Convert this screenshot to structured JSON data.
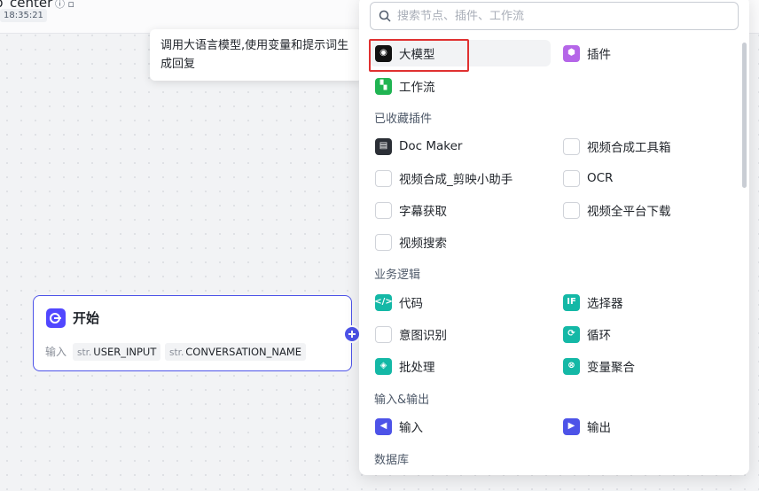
{
  "app": {
    "name": "p_center",
    "time": "18:35:21"
  },
  "tooltip": {
    "text": "调用大语言模型,使用变量和提示词生成回复"
  },
  "start_node": {
    "title": "开始",
    "inputs_label": "输入",
    "inputs": [
      {
        "type": "str.",
        "name": "USER_INPUT"
      },
      {
        "type": "str.",
        "name": "CONVERSATION_NAME"
      }
    ]
  },
  "panel": {
    "search_placeholder": "搜索节点、插件、工作流",
    "top_items": [
      {
        "label": "大模型",
        "icon": "llm-icon",
        "color": "#111111"
      },
      {
        "label": "插件",
        "icon": "plugin-icon",
        "color": "#b566e8"
      },
      {
        "label": "工作流",
        "icon": "workflow-icon",
        "color": "#20b452"
      }
    ],
    "favorites": {
      "title": "已收藏插件",
      "items": [
        {
          "label": "Doc Maker",
          "icon": "doc-maker-icon"
        },
        {
          "label": "视频合成工具箱",
          "icon": "plugin-placeholder-icon"
        },
        {
          "label": "视频合成_剪映小助手",
          "icon": "plugin-placeholder-icon"
        },
        {
          "label": "OCR",
          "icon": "plugin-placeholder-icon"
        },
        {
          "label": "字幕获取",
          "icon": "plugin-placeholder-icon"
        },
        {
          "label": "视频全平台下载",
          "icon": "plugin-placeholder-icon"
        },
        {
          "label": "视频搜索",
          "icon": "plugin-placeholder-icon"
        }
      ]
    },
    "logic": {
      "title": "业务逻辑",
      "items": [
        {
          "label": "代码",
          "icon": "code-icon",
          "color": "#14b8a6"
        },
        {
          "label": "选择器",
          "icon": "if-icon",
          "color": "#14b8a6"
        },
        {
          "label": "意图识别",
          "icon": "intent-placeholder-icon"
        },
        {
          "label": "循环",
          "icon": "loop-icon",
          "color": "#14b8a6"
        },
        {
          "label": "批处理",
          "icon": "batch-icon",
          "color": "#14b8a6"
        },
        {
          "label": "变量聚合",
          "icon": "variable-merge-icon",
          "color": "#14b8a6"
        }
      ]
    },
    "io": {
      "title": "输入&输出",
      "items": [
        {
          "label": "输入",
          "icon": "input-icon",
          "color": "#4d53e8"
        },
        {
          "label": "输出",
          "icon": "output-icon",
          "color": "#4d53e8"
        }
      ]
    },
    "database": {
      "title": "数据库"
    }
  }
}
